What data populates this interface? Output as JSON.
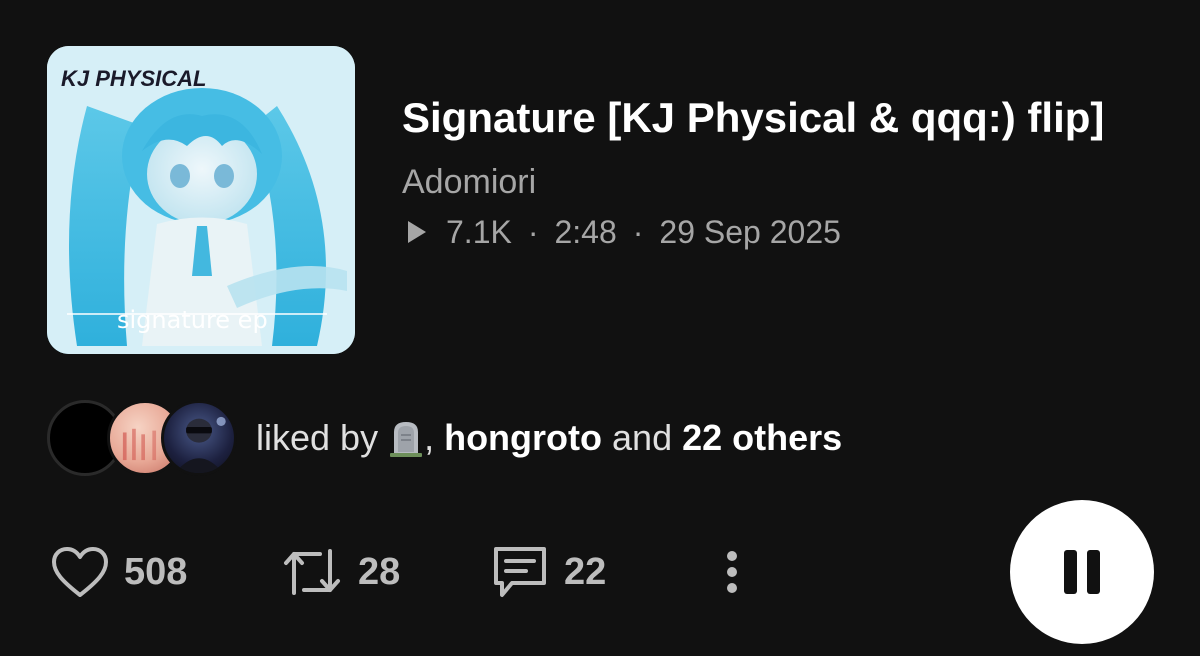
{
  "track": {
    "title": "Signature [KJ Physical & qqq:) flip]",
    "artist": "Adomiori",
    "plays": "7.1K",
    "duration": "2:48",
    "date": "29 Sep 2025",
    "separator": "·",
    "artwork": {
      "logo_text": "KJ PHYSICAL",
      "caption": "signature ep"
    }
  },
  "liked_by": {
    "prefix": "liked by",
    "user_icon": "headstone-emoji",
    "comma": ",",
    "user": "hongroto",
    "conjunction": "and",
    "others": "22 others"
  },
  "actions": {
    "likes": "508",
    "reposts": "28",
    "comments": "22"
  },
  "colors": {
    "background": "#111111",
    "primary_text": "#ffffff",
    "secondary_text": "#a6a6a6",
    "icon": "#bdbdbd",
    "pause_button_bg": "#ffffff",
    "pause_button_fg": "#111111"
  },
  "icons": [
    "play-icon",
    "heart-icon",
    "repost-icon",
    "comment-icon",
    "more-vertical-icon",
    "pause-icon"
  ]
}
